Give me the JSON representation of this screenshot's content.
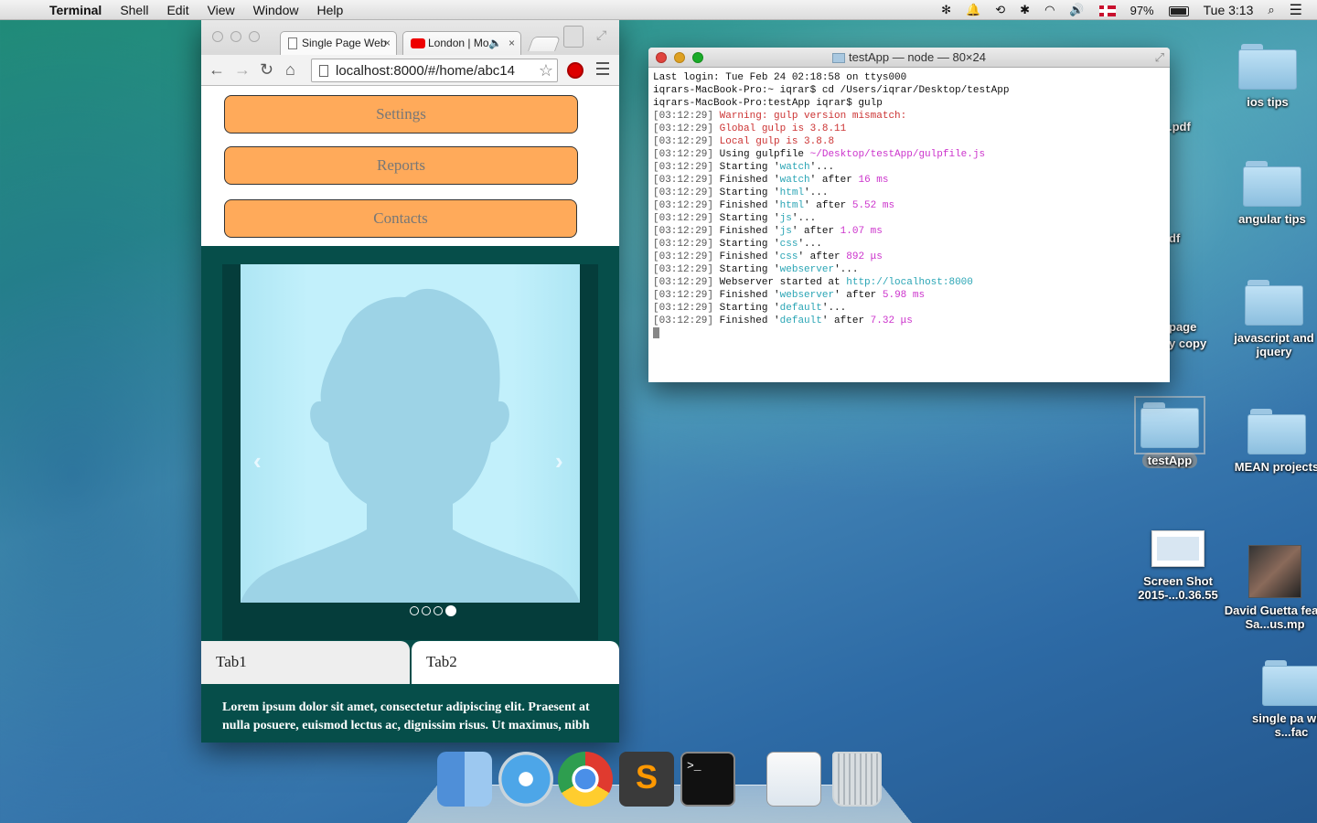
{
  "menubar": {
    "app_name": "Terminal",
    "menus": [
      "Shell",
      "Edit",
      "View",
      "Window",
      "Help"
    ],
    "battery": "97%",
    "clock": "Tue 3:13"
  },
  "desktop": {
    "icons": [
      {
        "label": "ios  tips"
      },
      {
        "label": "angular tips"
      },
      {
        "label": "javascript and jquery"
      },
      {
        "label": "testApp"
      },
      {
        "label": "MEAN projects"
      },
      {
        "label": "Screen Shot 2015-...0.36.55"
      },
      {
        "label": "David Guetta feat. Sa...us.mp"
      },
      {
        "label": "single pa with s...fac"
      }
    ],
    "partial_labels": [
      "he-",
      ".pdf",
      "df",
      "page",
      "y copy"
    ]
  },
  "browser": {
    "tabs": [
      {
        "title": "Single Page Web"
      },
      {
        "title": "London | Mo"
      }
    ],
    "url": "localhost:8000/#/home/abc14",
    "nav_buttons": [
      "Settings",
      "Reports",
      "Contacts"
    ],
    "carousel": {
      "prev": "‹",
      "next": "›",
      "dot_count": 4,
      "active_dot": 4
    },
    "page_tabs": [
      "Tab1",
      "Tab2"
    ],
    "lorem": "Lorem ipsum dolor sit amet, consectetur adipiscing elit. Praesent at nulla posuere, euismod lectus ac, dignissim risus. Ut maximus, nibh"
  },
  "terminal": {
    "title": "testApp — node — 80×24",
    "lines": [
      {
        "parts": [
          {
            "t": "Last login: Tue Feb 24 02:18:58 on ttys000",
            "c": ""
          }
        ]
      },
      {
        "parts": [
          {
            "t": "iqrars-MacBook-Pro:~ iqrar$ cd /Users/iqrar/Desktop/testApp",
            "c": ""
          }
        ]
      },
      {
        "parts": [
          {
            "t": "iqrars-MacBook-Pro:testApp iqrar$ gulp",
            "c": ""
          }
        ]
      },
      {
        "parts": [
          {
            "t": "[03:12:29]",
            "c": "ts"
          },
          {
            "t": " ",
            "c": ""
          },
          {
            "t": "Warning: gulp version mismatch:",
            "c": "red"
          }
        ]
      },
      {
        "parts": [
          {
            "t": "[03:12:29]",
            "c": "ts"
          },
          {
            "t": " ",
            "c": ""
          },
          {
            "t": "Global gulp is 3.8.11",
            "c": "red"
          }
        ]
      },
      {
        "parts": [
          {
            "t": "[03:12:29]",
            "c": "ts"
          },
          {
            "t": " ",
            "c": ""
          },
          {
            "t": "Local gulp is 3.8.8",
            "c": "red"
          }
        ]
      },
      {
        "parts": [
          {
            "t": "[03:12:29]",
            "c": "ts"
          },
          {
            "t": " Using gulpfile ",
            "c": ""
          },
          {
            "t": "~/Desktop/testApp/gulpfile.js",
            "c": "mg"
          }
        ]
      },
      {
        "parts": [
          {
            "t": "[03:12:29]",
            "c": "ts"
          },
          {
            "t": " Starting '",
            "c": ""
          },
          {
            "t": "watch",
            "c": "cy"
          },
          {
            "t": "'...",
            "c": ""
          }
        ]
      },
      {
        "parts": [
          {
            "t": "[03:12:29]",
            "c": "ts"
          },
          {
            "t": " Finished '",
            "c": ""
          },
          {
            "t": "watch",
            "c": "cy"
          },
          {
            "t": "' after ",
            "c": ""
          },
          {
            "t": "16 ms",
            "c": "mg"
          }
        ]
      },
      {
        "parts": [
          {
            "t": "[03:12:29]",
            "c": "ts"
          },
          {
            "t": " Starting '",
            "c": ""
          },
          {
            "t": "html",
            "c": "cy"
          },
          {
            "t": "'...",
            "c": ""
          }
        ]
      },
      {
        "parts": [
          {
            "t": "[03:12:29]",
            "c": "ts"
          },
          {
            "t": " Finished '",
            "c": ""
          },
          {
            "t": "html",
            "c": "cy"
          },
          {
            "t": "' after ",
            "c": ""
          },
          {
            "t": "5.52 ms",
            "c": "mg"
          }
        ]
      },
      {
        "parts": [
          {
            "t": "[03:12:29]",
            "c": "ts"
          },
          {
            "t": " Starting '",
            "c": ""
          },
          {
            "t": "js",
            "c": "cy"
          },
          {
            "t": "'...",
            "c": ""
          }
        ]
      },
      {
        "parts": [
          {
            "t": "[03:12:29]",
            "c": "ts"
          },
          {
            "t": " Finished '",
            "c": ""
          },
          {
            "t": "js",
            "c": "cy"
          },
          {
            "t": "' after ",
            "c": ""
          },
          {
            "t": "1.07 ms",
            "c": "mg"
          }
        ]
      },
      {
        "parts": [
          {
            "t": "[03:12:29]",
            "c": "ts"
          },
          {
            "t": " Starting '",
            "c": ""
          },
          {
            "t": "css",
            "c": "cy"
          },
          {
            "t": "'...",
            "c": ""
          }
        ]
      },
      {
        "parts": [
          {
            "t": "[03:12:29]",
            "c": "ts"
          },
          {
            "t": " Finished '",
            "c": ""
          },
          {
            "t": "css",
            "c": "cy"
          },
          {
            "t": "' after ",
            "c": ""
          },
          {
            "t": "892 μs",
            "c": "mg"
          }
        ]
      },
      {
        "parts": [
          {
            "t": "[03:12:29]",
            "c": "ts"
          },
          {
            "t": " Starting '",
            "c": ""
          },
          {
            "t": "webserver",
            "c": "cy"
          },
          {
            "t": "'...",
            "c": ""
          }
        ]
      },
      {
        "parts": [
          {
            "t": "[03:12:29]",
            "c": "ts"
          },
          {
            "t": " Webserver started at ",
            "c": ""
          },
          {
            "t": "http://localhost:8000",
            "c": "cy"
          }
        ]
      },
      {
        "parts": [
          {
            "t": "[03:12:29]",
            "c": "ts"
          },
          {
            "t": " Finished '",
            "c": ""
          },
          {
            "t": "webserver",
            "c": "cy"
          },
          {
            "t": "' after ",
            "c": ""
          },
          {
            "t": "5.98 ms",
            "c": "mg"
          }
        ]
      },
      {
        "parts": [
          {
            "t": "[03:12:29]",
            "c": "ts"
          },
          {
            "t": " Starting '",
            "c": ""
          },
          {
            "t": "default",
            "c": "cy"
          },
          {
            "t": "'...",
            "c": ""
          }
        ]
      },
      {
        "parts": [
          {
            "t": "[03:12:29]",
            "c": "ts"
          },
          {
            "t": " Finished '",
            "c": ""
          },
          {
            "t": "default",
            "c": "cy"
          },
          {
            "t": "' after ",
            "c": ""
          },
          {
            "t": "7.32 μs",
            "c": "mg"
          }
        ]
      }
    ]
  },
  "dock": {
    "apps": [
      {
        "name": "finder-icon"
      },
      {
        "name": "safari-icon"
      },
      {
        "name": "chrome-icon"
      },
      {
        "name": "sublime-text-icon",
        "glyph": "S"
      },
      {
        "name": "terminal-icon",
        "glyph": ">_"
      },
      {
        "name": "preview-icon"
      },
      {
        "name": "trash-icon"
      }
    ]
  },
  "colors": {
    "nav_button": "#ffaa5a",
    "teal_section": "#064e4a",
    "terminal_warning": "#cc3333",
    "terminal_task": "#2aa5b5",
    "terminal_time": "#cc33cc"
  }
}
